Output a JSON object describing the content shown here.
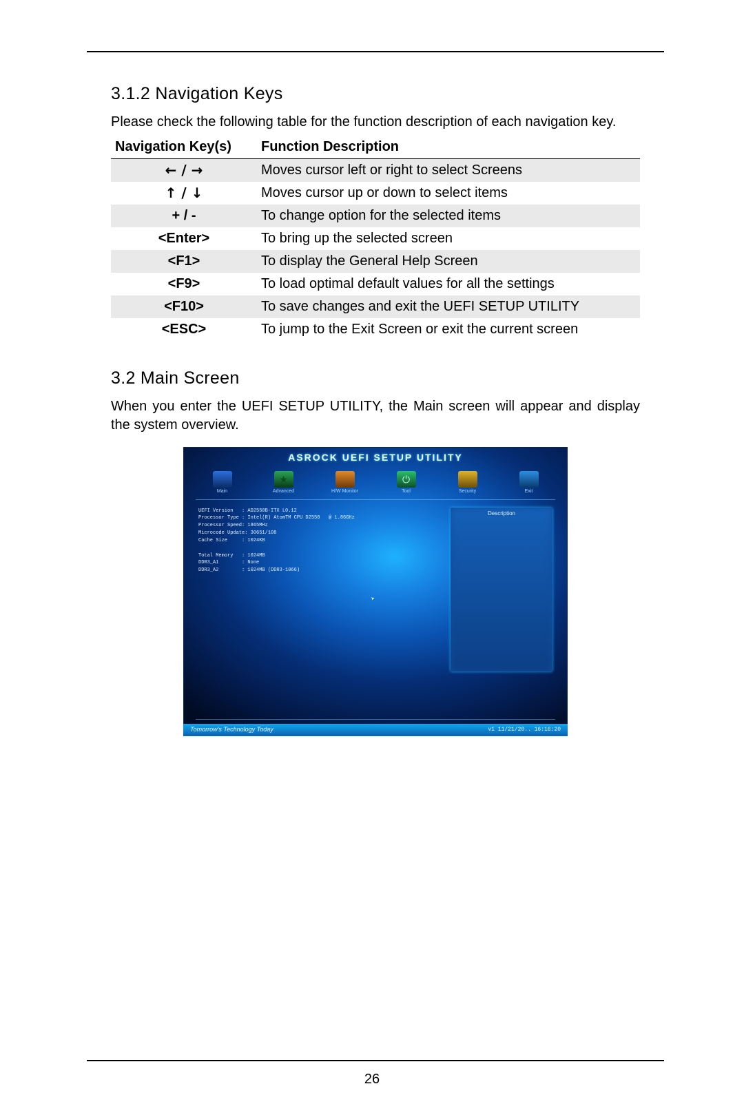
{
  "section_312": {
    "heading": "3.1.2  Navigation Keys",
    "intro": "Please check the following table for the function description of each navigation key."
  },
  "nav_table": {
    "header_keys": "Navigation Key(s)",
    "header_desc": "Function Description",
    "rows": [
      {
        "key": "← / →",
        "desc": "Moves cursor left or right to select Screens"
      },
      {
        "key": "↑ / ↓",
        "desc": "Moves cursor up or down to select items"
      },
      {
        "key": "+  /  -",
        "desc": "To change option for the selected items"
      },
      {
        "key": "<Enter>",
        "desc": "To bring up the selected screen"
      },
      {
        "key": "<F1>",
        "desc": "To display the General Help Screen"
      },
      {
        "key": "<F9>",
        "desc": "To load optimal default values for all the settings"
      },
      {
        "key": "<F10>",
        "desc": "To save changes and exit the UEFI SETUP UTILITY"
      },
      {
        "key": "<ESC>",
        "desc": "To jump to the Exit Screen or exit the current screen"
      }
    ]
  },
  "section_32": {
    "heading": "3.2   Main Screen",
    "intro": "When you enter the UEFI SETUP UTILITY, the Main screen will appear and display the system overview."
  },
  "uefi": {
    "title": "ASROCK UEFI SETUP UTILITY",
    "tabs": [
      "Main",
      "Advanced",
      "H/W Monitor",
      "Tool",
      "Security",
      "Exit"
    ],
    "desc_label": "Description",
    "info_lines": "UEFI Version   : AD2550B-ITX L0.12\nProcessor Type : Intel(R) AtomTM CPU D2550   @ 1.86GHz\nProcessor Speed: 1865MHz\nMicrocode Update: 30651/108\nCache Size     : 1024KB\n\nTotal Memory   : 1024MB\nDDR3_A1        : None\nDDR3_A2        : 1024MB (DDR3-1066)",
    "footer_left": "Tomorrow's Technology Today",
    "footer_right": "v1  11/21/20..  16:16:20"
  },
  "page_number": "26"
}
